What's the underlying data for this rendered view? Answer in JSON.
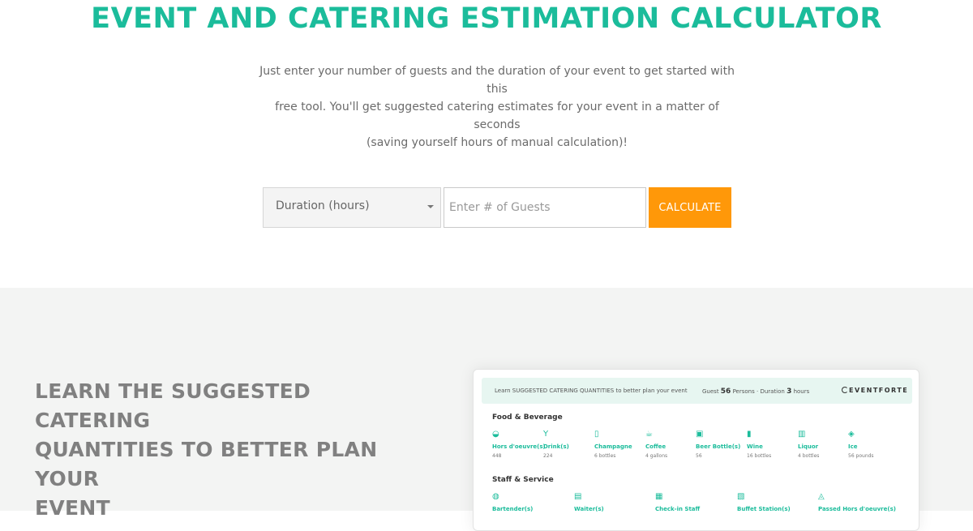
{
  "hero": {
    "title": "EVENT AND CATERING ESTIMATION CALCULATOR",
    "intro_lines": [
      "Just enter your number of guests and the duration of your event to get started with this",
      "free tool. You'll get suggested catering estimates for your event in a matter of seconds",
      "(saving yourself hours of manual calculation)!"
    ],
    "title_color": "#1bbc9b"
  },
  "form": {
    "duration_label": "Duration (hours)",
    "guests_placeholder": "Enter # of Guests",
    "guests_value": "",
    "calculate_label": "CALCULATE",
    "button_color": "#ff9809"
  },
  "lower": {
    "heading_lines": [
      "LEARN THE SUGGESTED CATERING",
      "QUANTITIES TO BETTER PLAN YOUR",
      "EVENT"
    ],
    "background": "#f3f4f3"
  },
  "preview": {
    "tagline": "Learn SUGGESTED CATERING QUANTITIES to better plan your event",
    "guest_label": "Guest",
    "guest_count": "56",
    "persons_label": "Persons",
    "separator": "·",
    "duration_label": "Duration",
    "duration_value": "3",
    "hours_label": "hours",
    "brand": "EVENTFORTE",
    "food_section": "Food & Beverage",
    "food_items": [
      {
        "name": "Hors d'oeuvre(s)",
        "qty": "448",
        "icon": "plate-icon"
      },
      {
        "name": "Drink(s)",
        "qty": "224",
        "icon": "cocktail-icon"
      },
      {
        "name": "Champagne",
        "qty": "6 bottles",
        "icon": "champagne-bottle-icon"
      },
      {
        "name": "Coffee",
        "qty": "4 gallons",
        "icon": "coffee-icon"
      },
      {
        "name": "Beer Bottle(s)",
        "qty": "56",
        "icon": "beer-icon"
      },
      {
        "name": "Wine",
        "qty": "16 bottles",
        "icon": "wine-bottle-icon"
      },
      {
        "name": "Liquor",
        "qty": "4 bottles",
        "icon": "liquor-icon"
      },
      {
        "name": "Ice",
        "qty": "56 pounds",
        "icon": "ice-icon"
      }
    ],
    "staff_section": "Staff & Service",
    "staff_items": [
      {
        "name": "Bartender(s)",
        "icon": "bartender-icon"
      },
      {
        "name": "Waiter(s)",
        "icon": "waiter-icon"
      },
      {
        "name": "Check-in Staff",
        "icon": "check-in-icon"
      },
      {
        "name": "Buffet Station(s)",
        "icon": "buffet-icon"
      },
      {
        "name": "Passed Hors d'oeuvre(s)",
        "icon": "tray-icon"
      }
    ]
  }
}
